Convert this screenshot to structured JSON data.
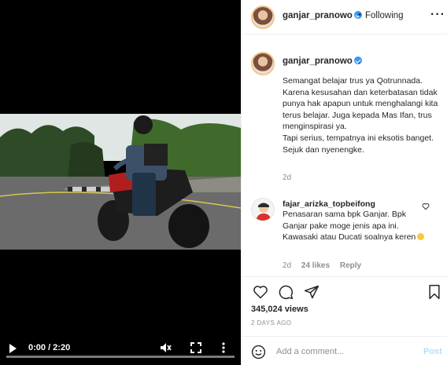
{
  "video": {
    "time": "0:00 / 2:20",
    "icons": [
      "play-icon",
      "mute-icon",
      "fullscreen-icon",
      "more-icon"
    ],
    "progress": 0
  },
  "post": {
    "username": "ganjar_pranowo",
    "header_separator": "•",
    "follow_status": "Following",
    "caption_period": ".",
    "caption": "Semangat belajar trus ya Qotrunnada. Karena kesusahan dan keterbatasan tidak punya hak apapun untuk menghalangi kita terus belajar. Juga kepada Mas Ifan, trus menginspirasi ya.\nTapi serius, tempatnya ini eksotis banget. Sejuk dan nyenengke.",
    "caption_time": "2d",
    "views": "345,024 views",
    "date": "2 DAYS AGO"
  },
  "comment": {
    "username": "fajar_arizka_topbeifong",
    "text": "Penasaran sama bpk Ganjar. Bpk Ganjar pake moge jenis apa ini. Kawasaki atau Ducati soalnya keren",
    "time": "2d",
    "likes": "24 likes",
    "reply": "Reply"
  },
  "add_comment": {
    "placeholder": "Add a comment...",
    "post_label": "Post"
  },
  "colors": {
    "accent": "#3897f0",
    "post_disabled": "#b2dffc",
    "muted": "#8e8e8e"
  }
}
